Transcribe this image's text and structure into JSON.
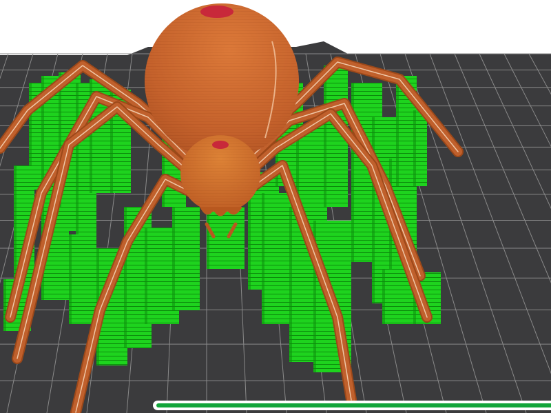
{
  "viewport": {
    "kind": "3d-print-layer-preview",
    "object": "spider-model",
    "colors": {
      "background": "#ffffff",
      "build_plate": "#3b3b3d",
      "grid_line": "#8a8a8a",
      "model": "#c0602c",
      "model_highlight": "#e0803a",
      "model_top_layer": "#c8283a",
      "support": "#1bd61b",
      "support_dark": "#0d8f0d"
    }
  },
  "layer_progress": {
    "fraction": 1.0,
    "color": "#12a53a"
  }
}
